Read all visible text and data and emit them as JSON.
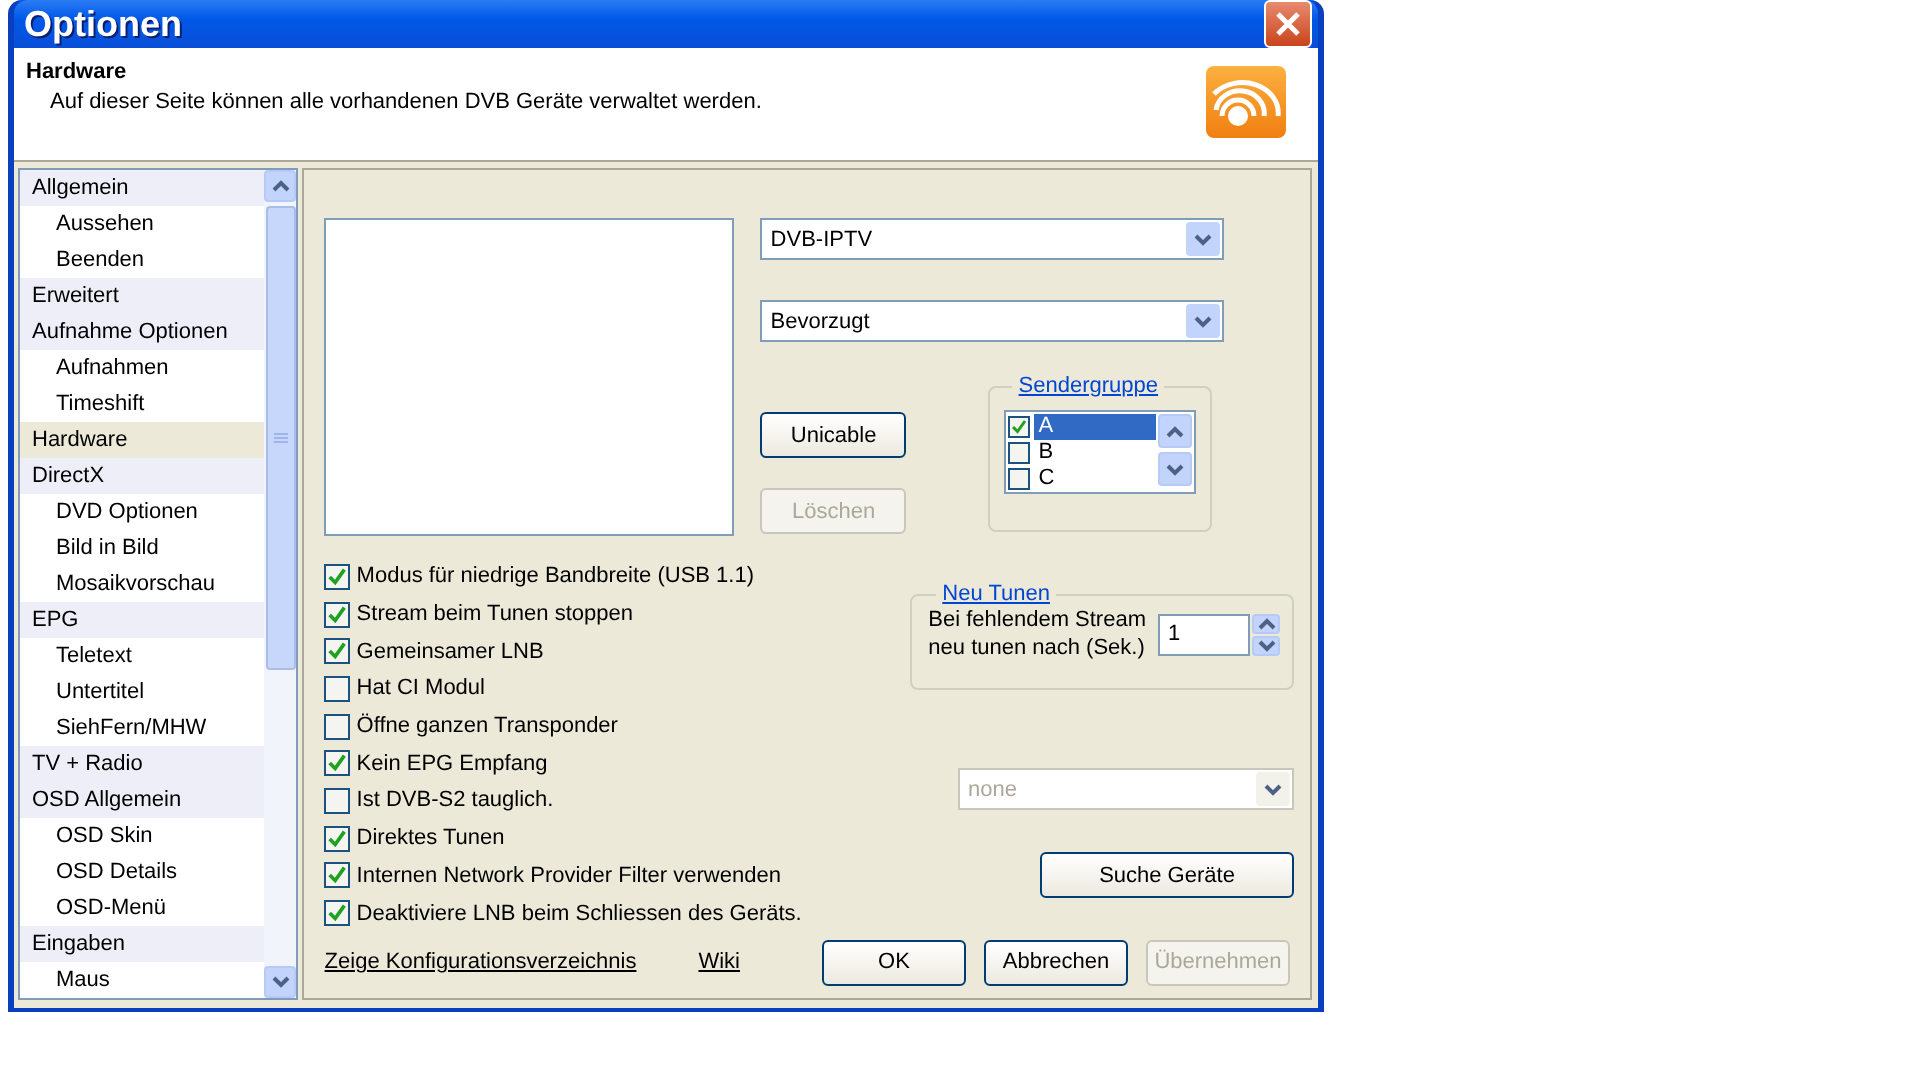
{
  "window": {
    "title": "Optionen"
  },
  "header": {
    "title": "Hardware",
    "description": "Auf dieser Seite können alle vorhandenen DVB Geräte verwaltet werden."
  },
  "sidebar": {
    "items": [
      {
        "label": "Allgemein",
        "selected": false,
        "children": [
          {
            "label": "Aussehen",
            "selected": false
          },
          {
            "label": "Beenden",
            "selected": false
          }
        ]
      },
      {
        "label": "Erweitert",
        "selected": false
      },
      {
        "label": "Aufnahme Optionen",
        "selected": false,
        "children": [
          {
            "label": "Aufnahmen",
            "selected": false
          },
          {
            "label": "Timeshift",
            "selected": false
          }
        ]
      },
      {
        "label": "Hardware",
        "selected": true
      },
      {
        "label": "DirectX",
        "selected": false,
        "children": [
          {
            "label": "DVD Optionen",
            "selected": false
          },
          {
            "label": "Bild in Bild",
            "selected": false
          },
          {
            "label": "Mosaikvorschau",
            "selected": false
          }
        ]
      },
      {
        "label": "EPG",
        "selected": false,
        "children": [
          {
            "label": "Teletext",
            "selected": false
          },
          {
            "label": "Untertitel",
            "selected": false
          },
          {
            "label": "SiehFern/MHW",
            "selected": false
          }
        ]
      },
      {
        "label": "TV + Radio",
        "selected": false
      },
      {
        "label": "OSD Allgemein",
        "selected": false,
        "children": [
          {
            "label": "OSD Skin",
            "selected": false
          },
          {
            "label": "OSD Details",
            "selected": false
          },
          {
            "label": "OSD-Menü",
            "selected": false
          }
        ]
      },
      {
        "label": "Eingaben",
        "selected": false,
        "children": [
          {
            "label": "Maus",
            "selected": false
          }
        ]
      }
    ]
  },
  "device_type": {
    "value": "DVB-IPTV",
    "disabled": false
  },
  "priority": {
    "value": "Bevorzugt",
    "disabled": false
  },
  "device_buttons": [
    {
      "label": "Unicable",
      "disabled": false
    },
    {
      "label": "Löschen",
      "disabled": true
    }
  ],
  "sendergruppe": {
    "legend": "Sendergruppe",
    "items": [
      {
        "label": "A",
        "checked": true,
        "selected": true
      },
      {
        "label": "B",
        "checked": false,
        "selected": false
      },
      {
        "label": "C",
        "checked": false,
        "selected": false
      }
    ]
  },
  "options": [
    {
      "label": "Modus für niedrige Bandbreite (USB 1.1)",
      "checked": true
    },
    {
      "label": "Stream beim Tunen stoppen",
      "checked": true
    },
    {
      "label": "Gemeinsamer LNB",
      "checked": true
    },
    {
      "label": "Hat CI Modul",
      "checked": false
    },
    {
      "label": "Öffne ganzen Transponder",
      "checked": false
    },
    {
      "label": "Kein EPG Empfang",
      "checked": true
    },
    {
      "label": "Ist DVB-S2 tauglich.",
      "checked": false
    },
    {
      "label": "Direktes Tunen",
      "checked": true
    },
    {
      "label": "Internen Network Provider Filter verwenden",
      "checked": true
    },
    {
      "label": "Deaktiviere LNB beim Schliessen des Geräts.",
      "checked": true
    }
  ],
  "neu_tunen": {
    "legend": "Neu Tunen",
    "label": "Bei fehlendem Stream\nneu tunen nach (Sek.)",
    "value": "1"
  },
  "dvbs2_mode": {
    "value": "none",
    "disabled": true
  },
  "search_button": {
    "label": "Suche Geräte"
  },
  "footer": {
    "links": [
      "Zeige Konfigurationsverzeichnis",
      "Wiki"
    ],
    "buttons": [
      {
        "label": "OK",
        "disabled": false
      },
      {
        "label": "Abbrechen",
        "disabled": false
      },
      {
        "label": "Übernehmen",
        "disabled": true
      }
    ]
  }
}
